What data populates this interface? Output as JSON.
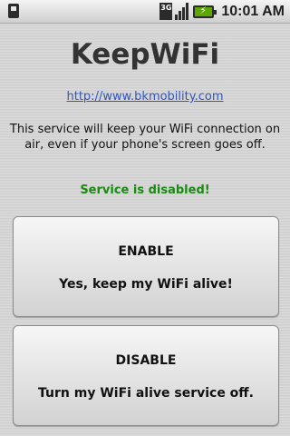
{
  "status_bar": {
    "network_type": "3G",
    "time": "10:01 AM",
    "battery_bolt": "⚡"
  },
  "app": {
    "title": "KeepWiFi",
    "link": "http://www.bkmobility.com",
    "description": "This service will keep your WiFi connection on air, even if your phone's screen goes off.",
    "service_status": "Service is disabled!",
    "status_color": "#1a8a12"
  },
  "buttons": {
    "enable": {
      "label": "ENABLE",
      "subtitle": "Yes, keep my WiFi alive!"
    },
    "disable": {
      "label": "DISABLE",
      "subtitle": "Turn my WiFi alive service off."
    }
  }
}
